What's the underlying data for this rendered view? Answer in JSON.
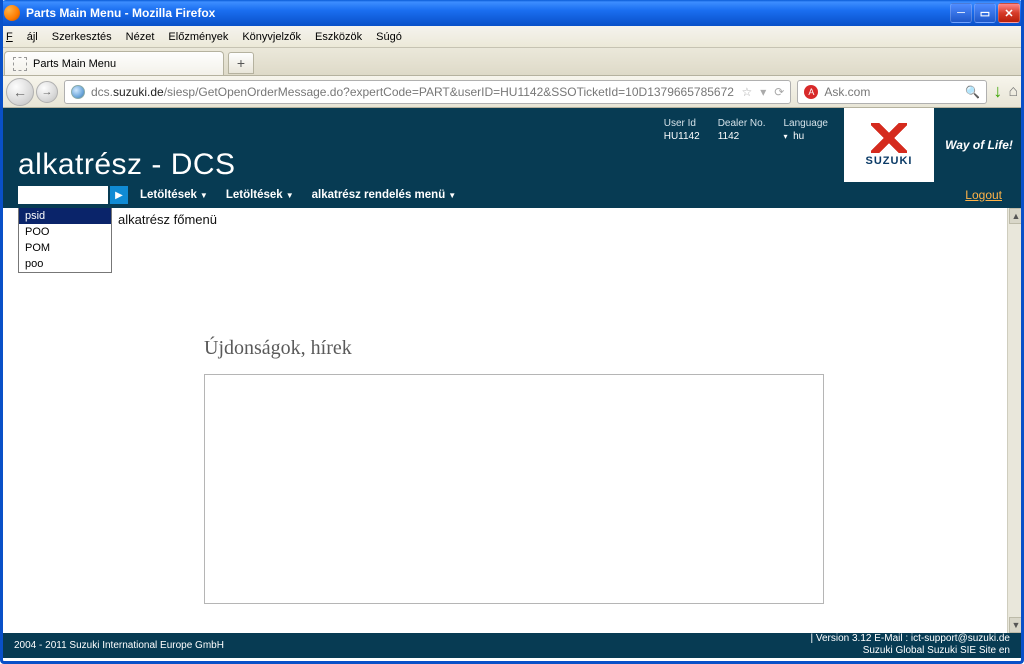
{
  "window": {
    "title": "Parts Main Menu - Mozilla Firefox"
  },
  "browser_menu": {
    "file": "Fájl",
    "edit": "Szerkesztés",
    "view": "Nézet",
    "history": "Előzmények",
    "bookmarks": "Könyvjelzők",
    "tools": "Eszközök",
    "help": "Súgó"
  },
  "tab": {
    "title": "Parts Main Menu",
    "newtab_glyph": "+"
  },
  "nav": {
    "back": "←",
    "forward": "→",
    "url_prefix": "dcs.",
    "url_domain": "suzuki.de",
    "url_path": "/siesp/GetOpenOrderMessage.do?expertCode=PART&userID=HU1142&SSOTicketId=10D1379665785672",
    "star": "☆",
    "dropdown": "▾",
    "reload": "⟳",
    "search_provider": "Ask.com",
    "download": "↓",
    "home": "⌂"
  },
  "app": {
    "title": "alkatrész - DCS",
    "info": {
      "user_label": "User Id",
      "user_value": "HU1142",
      "dealer_label": "Dealer No.",
      "dealer_value": "1142",
      "lang_label": "Language",
      "lang_value": "hu"
    },
    "brand": "SUZUKI",
    "slogan": "Way of Life!",
    "menus": {
      "m1": "Letöltések",
      "m2": "Letöltések",
      "m3": "alkatrész rendelés menü"
    },
    "logout": "Logout",
    "dropdown": {
      "i0": "psid",
      "i1": "POO",
      "i2": "POM",
      "i3": "poo"
    },
    "breadcrumb": "alkatrész főmenü",
    "news_heading": "Újdonságok, hírek"
  },
  "footer": {
    "copyright": "2004 - 2011 Suzuki International Europe GmbH",
    "line1": "| Version 3.12  E-Mail : ict-support@suzuki.de",
    "line2": "Suzuki Global Suzuki SIE Site en"
  }
}
